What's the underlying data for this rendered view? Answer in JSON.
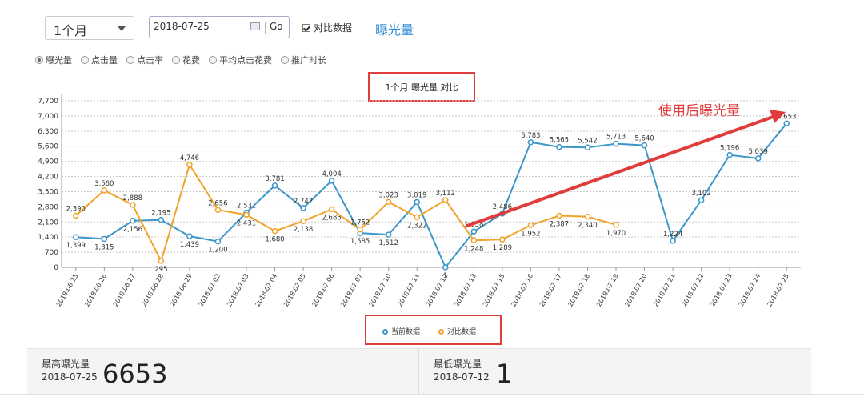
{
  "controls": {
    "period_select": "1个月",
    "date_value": "2018-07-25",
    "go_label": "Go",
    "compare_label": "对比数据",
    "current_metric": "曝光量"
  },
  "metric_tabs": [
    {
      "label": "曝光量",
      "selected": true
    },
    {
      "label": "点击量",
      "selected": false
    },
    {
      "label": "点击率",
      "selected": false
    },
    {
      "label": "花费",
      "selected": false
    },
    {
      "label": "平均点击花费",
      "selected": false
    },
    {
      "label": "推广时长",
      "selected": false
    }
  ],
  "annotation": "使用后曝光量",
  "stats": {
    "max_label": "最高曝光量",
    "max_date": "2018-07-25",
    "max_value": "6653",
    "min_label": "最低曝光量",
    "min_date": "2018-07-12",
    "min_value": "1"
  },
  "colors": {
    "current": "#3b96c9",
    "compare": "#f0a32a",
    "accent_red": "#e03c3c",
    "link_blue": "#3a8fd6"
  },
  "chart_data": {
    "type": "line",
    "title": "1个月  曝光量  对比",
    "categories": [
      "2018.06.25",
      "2018.06.26",
      "2018.06.27",
      "2018.06.28",
      "2018.06.29",
      "2018.07.02",
      "2018.07.03",
      "2018.07.04",
      "2018.07.05",
      "2018.07.06",
      "2018.07.07",
      "2018.07.10",
      "2018.07.11",
      "2018.07.12",
      "2018.07.13",
      "2018.07.15",
      "2018.07.16",
      "2018.07.17",
      "2018.07.18",
      "2018.07.19",
      "2018.07.20",
      "2018.07.21",
      "2018.07.22",
      "2018.07.23",
      "2018.07.24",
      "2018.07.25"
    ],
    "series": [
      {
        "name": "当前数据",
        "values": [
          1399,
          1315,
          2156,
          2195,
          1439,
          1200,
          2531,
          3781,
          2742,
          4004,
          1585,
          1512,
          3019,
          1,
          1658,
          2486,
          5783,
          5565,
          5542,
          5713,
          5640,
          1224,
          3102,
          5196,
          5039,
          6653
        ]
      },
      {
        "name": "对比数据",
        "values": [
          2390,
          3560,
          2888,
          295,
          4746,
          2656,
          2431,
          1680,
          2138,
          2685,
          1752,
          3023,
          2322,
          3112,
          1248,
          1289,
          1952,
          2387,
          2340,
          1970,
          null,
          null,
          null,
          null,
          null,
          null
        ]
      }
    ],
    "yticks": [
      "0",
      "700",
      "1,400",
      "2,100",
      "2,800",
      "3,500",
      "4,200",
      "4,900",
      "5,600",
      "6,300",
      "7,000",
      "7,700"
    ],
    "ylim": [
      0,
      7700
    ],
    "grid": true,
    "legend_position": "bottom"
  }
}
